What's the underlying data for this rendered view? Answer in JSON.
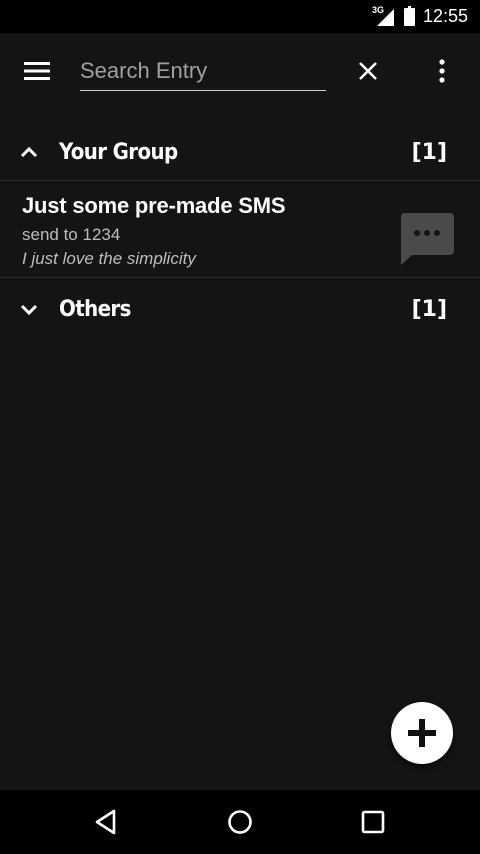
{
  "status_bar": {
    "network": "3G",
    "time": "12:55"
  },
  "app_bar": {
    "search_placeholder": "Search Entry",
    "search_value": ""
  },
  "groups": [
    {
      "name": "Your Group",
      "count": "[1]",
      "expanded": true
    },
    {
      "name": "Others",
      "count": "[1]",
      "expanded": false
    }
  ],
  "entries": [
    {
      "title": "Just some pre-made SMS",
      "recipient": "send to 1234",
      "note": "I just love the simplicity"
    }
  ],
  "colors": {
    "background": "#141414",
    "status_bar": "#000000",
    "divider": "#2e2e2e",
    "secondary_text": "#bdbdbd",
    "sms_icon": "#4a4a4a"
  },
  "icons": {
    "menu": "hamburger-icon",
    "clear": "close-icon",
    "overflow": "more-vert-icon",
    "expanded": "chevron-up-icon",
    "collapsed": "chevron-down-icon",
    "sms": "sms-icon",
    "add": "plus-icon",
    "back": "back-triangle-icon",
    "home": "home-circle-icon",
    "recents": "recents-square-icon"
  }
}
